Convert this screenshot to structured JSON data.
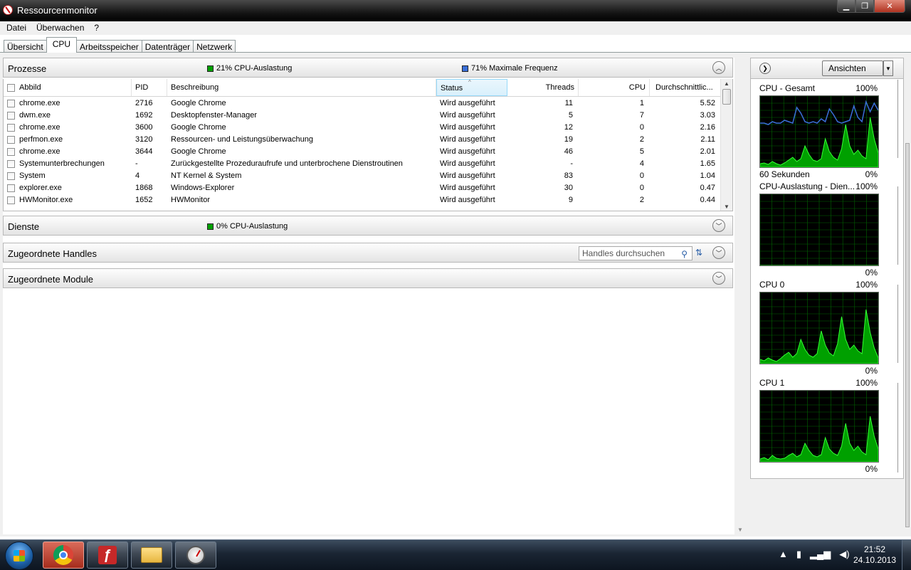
{
  "window": {
    "title": "Ressourcenmonitor"
  },
  "menu": [
    "Datei",
    "Überwachen",
    "?"
  ],
  "tabs": [
    "Übersicht",
    "CPU",
    "Arbeitsspeicher",
    "Datenträger",
    "Netzwerk"
  ],
  "active_tab": "CPU",
  "processes": {
    "title": "Prozesse",
    "cpu_stat": "21% CPU-Auslastung",
    "freq_stat": "71% Maximale Frequenz",
    "cpu_color": "#00a000",
    "freq_color": "#3a6fd8",
    "columns": [
      "Abbild",
      "PID",
      "Beschreibung",
      "Status",
      "Threads",
      "CPU",
      "Durchschnittlic..."
    ],
    "rows": [
      [
        "chrome.exe",
        "2716",
        "Google Chrome",
        "Wird ausgeführt",
        "11",
        "1",
        "5.52"
      ],
      [
        "dwm.exe",
        "1692",
        "Desktopfenster-Manager",
        "Wird ausgeführt",
        "5",
        "7",
        "3.03"
      ],
      [
        "chrome.exe",
        "3600",
        "Google Chrome",
        "Wird ausgeführt",
        "12",
        "0",
        "2.16"
      ],
      [
        "perfmon.exe",
        "3120",
        "Ressourcen- und Leistungsüberwachung",
        "Wird ausgeführt",
        "19",
        "2",
        "2.11"
      ],
      [
        "chrome.exe",
        "3644",
        "Google Chrome",
        "Wird ausgeführt",
        "46",
        "5",
        "2.01"
      ],
      [
        "Systemunterbrechungen",
        "-",
        "Zurückgestellte Prozeduraufrufe und unterbrochene Dienstroutinen",
        "Wird ausgeführt",
        "-",
        "4",
        "1.65"
      ],
      [
        "System",
        "4",
        "NT Kernel & System",
        "Wird ausgeführt",
        "83",
        "0",
        "1.04"
      ],
      [
        "explorer.exe",
        "1868",
        "Windows-Explorer",
        "Wird ausgeführt",
        "30",
        "0",
        "0.47"
      ],
      [
        "HWMonitor.exe",
        "1652",
        "HWMonitor",
        "Wird ausgeführt",
        "9",
        "2",
        "0.44"
      ]
    ]
  },
  "services": {
    "title": "Dienste",
    "cpu_stat": "0% CPU-Auslastung"
  },
  "handles": {
    "title": "Zugeordnete Handles",
    "search_placeholder": "Handles durchsuchen"
  },
  "modules": {
    "title": "Zugeordnete Module"
  },
  "right_panel": {
    "views_label": "Ansichten",
    "graphs": [
      {
        "title": "CPU - Gesamt",
        "max": "100%",
        "min": "0%",
        "sub": "60 Sekunden"
      },
      {
        "title": "CPU-Auslastung - Dien...",
        "max": "100%",
        "min": "0%"
      },
      {
        "title": "CPU 0",
        "max": "100%",
        "min": "0%"
      },
      {
        "title": "CPU 1",
        "max": "100%",
        "min": "0%"
      }
    ]
  },
  "taskbar": {
    "time": "21:52",
    "date": "24.10.2013"
  }
}
